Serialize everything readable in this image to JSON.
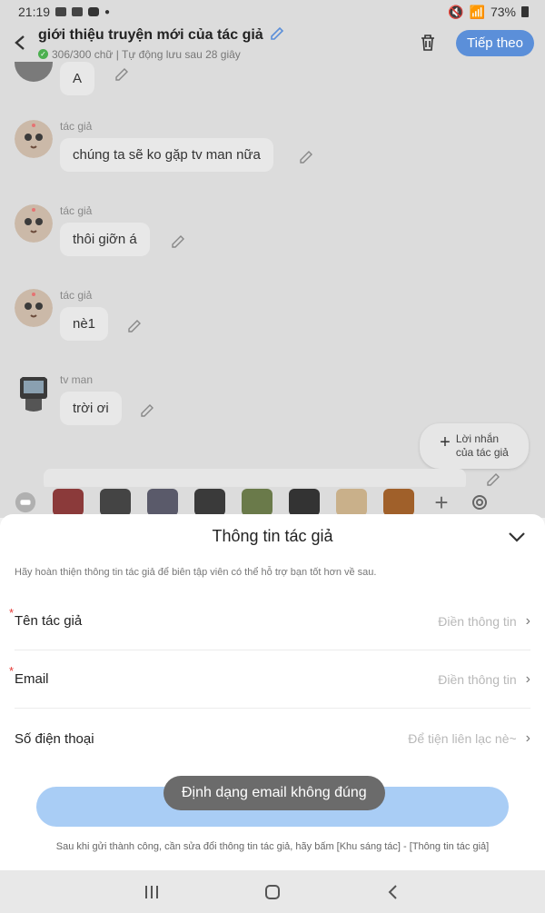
{
  "status": {
    "time": "21:19",
    "battery": "73%"
  },
  "header": {
    "title": "giới thiệu truyện mới của tác giả",
    "subtitle": "306/300 chữ | Tự động lưu sau 28 giây",
    "follow_label": "Tiếp theo"
  },
  "chat": {
    "messages": [
      {
        "author": "",
        "text": "A"
      },
      {
        "author": "tác giả",
        "text": "chúng ta sẽ ko gặp tv man nữa"
      },
      {
        "author": "tác giả",
        "text": "thôi giỡn á"
      },
      {
        "author": "tác giả",
        "text": "nè1"
      },
      {
        "author": "tv man",
        "text": "trời ơi"
      }
    ],
    "reply_fab": {
      "line1": "Lời nhắn",
      "line2": "của tác giả"
    }
  },
  "sheet": {
    "title": "Thông tin tác giả",
    "hint": "Hãy hoàn thiện thông tin tác giả để biên tập viên có thể hỗ trợ bạn tốt hơn về sau.",
    "rows": [
      {
        "label": "Tên tác giả",
        "required": "*",
        "placeholder": "Điền thông tin"
      },
      {
        "label": "Email",
        "required": "*",
        "placeholder": "Điền thông tin"
      },
      {
        "label": "Số điện thoại",
        "required": "",
        "placeholder": "Để tiện liên lạc nè~"
      }
    ],
    "toast": "Định dạng email không đúng",
    "footer": "Sau khi gửi thành công, cần sửa đổi thông tin tác giả, hãy bấm [Khu sáng tác] - [Thông tin tác giả]"
  },
  "colors": {
    "accent": "#5b8fd9",
    "submit": "#a9cdf5",
    "required": "#e53935"
  }
}
